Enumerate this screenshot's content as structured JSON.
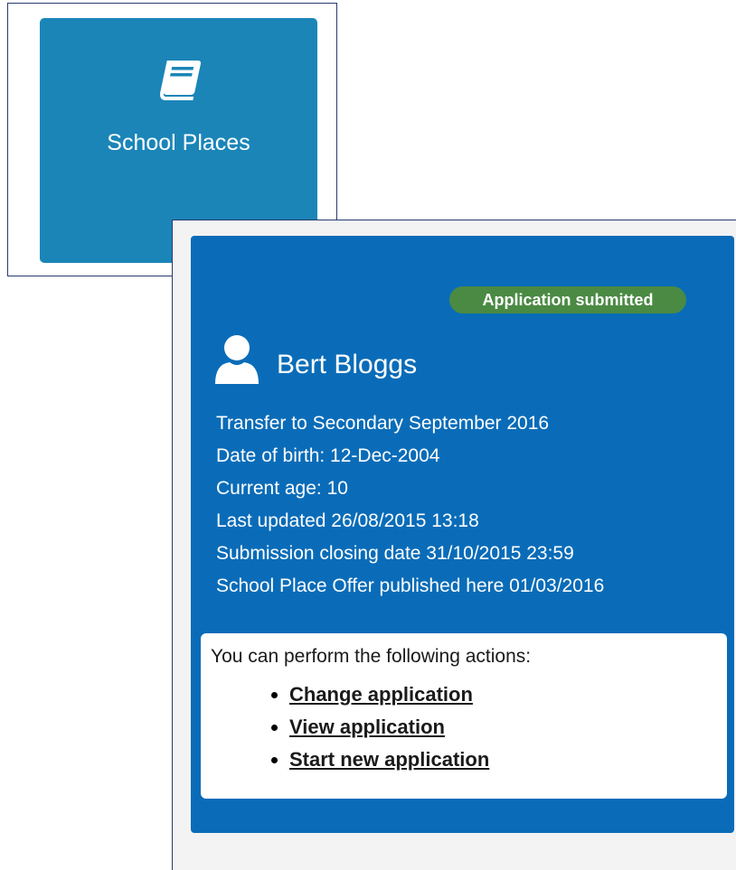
{
  "tile": {
    "label": "School Places",
    "icon": "book-icon",
    "background": "#1b85b8"
  },
  "application": {
    "status": "Application submitted",
    "status_color": "#4a8a43",
    "card_color": "#0a6cb8",
    "applicant_name": "Bert Bloggs",
    "avatar_icon": "user-icon",
    "details": {
      "transfer": "Transfer to Secondary September 2016",
      "dob": "Date of birth: 12-Dec-2004",
      "age": "Current age: 10",
      "updated": "Last updated 26/08/2015 13:18",
      "closing": "Submission closing date 31/10/2015 23:59",
      "offer": "School Place Offer published here 01/03/2016"
    }
  },
  "actions": {
    "intro": "You can perform the following actions:",
    "items": [
      {
        "label": "Change application"
      },
      {
        "label": "View application"
      },
      {
        "label": "Start new application"
      }
    ]
  }
}
